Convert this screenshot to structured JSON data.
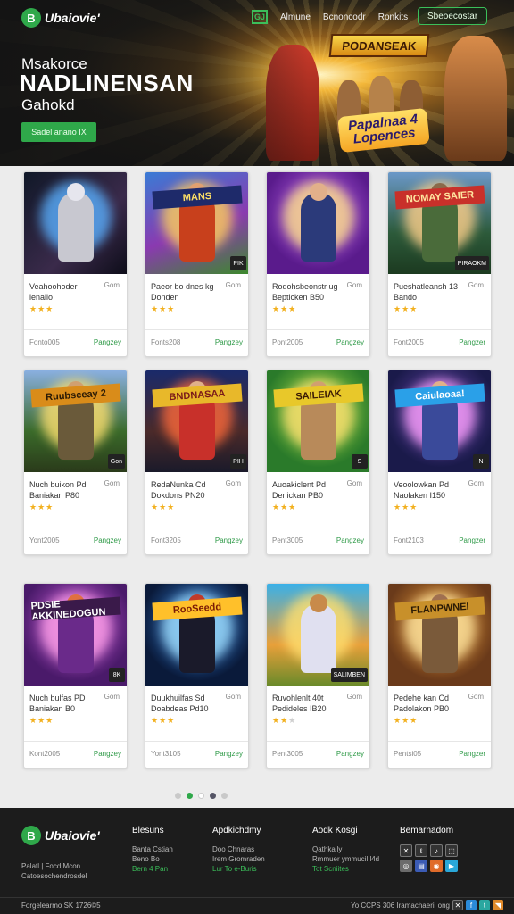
{
  "header": {
    "logo_text": "Ubaiovie'",
    "logo_glyph": "B",
    "nav_icon_label": "GJ",
    "nav": [
      "Almune",
      "Bcnoncodr",
      "Ronkits"
    ],
    "cta_label": "Sbeoecostar"
  },
  "hero": {
    "subtitle": "Msakorce",
    "title": "NADLINENSAN",
    "tagline": "Gahokd",
    "button_label": "Sadel anano IX",
    "game_title": "PODANSEAK",
    "game_subtitle": "Papalnaa 4\nLopences",
    "accent": "#2fa84a"
  },
  "cards": [
    {
      "title": "Veahoohoder\nlenalio",
      "meta": "Gom",
      "rating": 3,
      "date": "Fonto005",
      "action": "Pangzey",
      "banner": "",
      "badge": ""
    },
    {
      "title": "Paeor bo dnes kg\nDonden",
      "meta": "Gom",
      "rating": 3,
      "date": "Fonts208",
      "action": "Pangzey",
      "banner": "MANS",
      "badge": "PIK"
    },
    {
      "title": "Rodohsbeonstr ug\nBepticken B50",
      "meta": "Gom",
      "rating": 3,
      "date": "Pont2005",
      "action": "Pangzey",
      "banner": "",
      "badge": ""
    },
    {
      "title": "Pueshatleansh 13\nBando",
      "meta": "Gom",
      "rating": 3,
      "date": "Font2005",
      "action": "Pangzer",
      "banner": "NOMAY SAIER",
      "badge": "PIRAOKM"
    },
    {
      "title": "Nuch buikon Pd\nBaniakan P80",
      "meta": "Gom",
      "rating": 3,
      "date": "Yont2005",
      "action": "Pangzey",
      "banner": "Ruubsceay 2",
      "badge": "Gon"
    },
    {
      "title": "RedaNunka Cd\nDokdons PN20",
      "meta": "Gom",
      "rating": 3,
      "date": "Font3205",
      "action": "Pangzey",
      "banner": "BNDNASAA",
      "badge": "PIH"
    },
    {
      "title": "Auoakiclent Pd\nDenickan PB0",
      "meta": "Gom",
      "rating": 3,
      "date": "Pent3005",
      "action": "Pangzey",
      "banner": "SAILEIAK",
      "badge": "S"
    },
    {
      "title": "Veoolowkan Pd\nNaolaken I150",
      "meta": "Gom",
      "rating": 3,
      "date": "Font2103",
      "action": "Pangzer",
      "banner": "Caiulaoaa!",
      "badge": "N"
    },
    {
      "title": "Nuch bulfas PD\nBaniakan B0",
      "meta": "Gom",
      "rating": 3,
      "date": "Kont2005",
      "action": "Pangzey",
      "banner": "PDSIE AKKINEDOGUN",
      "badge": "8K"
    },
    {
      "title": "Duukhuilfas Sd\nDoabdeas Pd10",
      "meta": "Gom",
      "rating": 3,
      "date": "Yont3105",
      "action": "Pangzey",
      "banner": "RooSeedd",
      "badge": ""
    },
    {
      "title": "Ruvohlenlt 40t\nPedideles IB20",
      "meta": "Gom",
      "rating": 2,
      "date": "Pent3005",
      "action": "Pangzey",
      "banner": "",
      "badge": "SALIMBEN"
    },
    {
      "title": "Pedehe kan Cd\nPadolakon PB0",
      "meta": "Gom",
      "rating": 3,
      "date": "Pentsi05",
      "action": "Pangzer",
      "banner": "FLANPWNEI",
      "badge": ""
    }
  ],
  "footer": {
    "logo_text": "Ubaiovie'",
    "logo_glyph": "B",
    "tagline": "Palatl | Focd Mcon\nCatoesochendrosdel",
    "columns": [
      {
        "heading": "Blesuns",
        "links": [
          "Banta Cstian",
          "Beno Bo",
          "Bern 4 Pan"
        ]
      },
      {
        "heading": "Apdkichdmy",
        "links": [
          "Doo Chnaras",
          "Irem Gromraden",
          "Lur To e-Buris"
        ]
      },
      {
        "heading": "Aodk Kosgi",
        "links": [
          "Qathkally",
          "Rmmuer ymmucil l4d",
          "Tot Scniites"
        ]
      }
    ],
    "social_heading": "Bemarnadom",
    "copyright": "Forgelearmo SK 1726©5",
    "bottom_text": "Yo CCPS 306 Iramachaerii ong"
  }
}
